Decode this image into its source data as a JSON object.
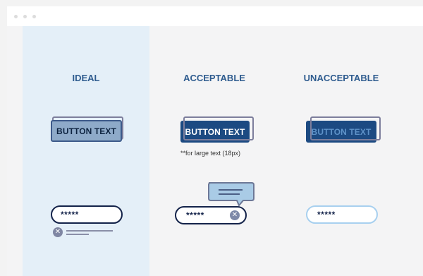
{
  "columns": {
    "ideal": {
      "label": "IDEAL"
    },
    "acceptable": {
      "label": "ACCEPTABLE"
    },
    "unacceptable": {
      "label": "UNACCEPTABLE"
    }
  },
  "buttons": {
    "ideal": {
      "label": "BUTTON TEXT"
    },
    "acceptable": {
      "label": "BUTTON TEXT",
      "note": "**for large text (18px)"
    },
    "unacceptable": {
      "label": "BUTTON TEXT"
    }
  },
  "password_fields": {
    "ideal": {
      "value": "*****"
    },
    "acceptable": {
      "value": "*****"
    },
    "unacceptable": {
      "value": "*****"
    }
  },
  "icons": {
    "window_controls": [
      "window-dot-icon",
      "window-dot-icon",
      "window-dot-icon"
    ],
    "clear": "close-icon",
    "tooltip": "tooltip-icon"
  },
  "colors": {
    "heading": "#2f5c8f",
    "ideal_background": "#e4eff8",
    "dark_navy": "#14234a",
    "button_blue": "#1c4a82",
    "ideal_button": "#8eaac9",
    "light_border": "#a8d0ef"
  }
}
